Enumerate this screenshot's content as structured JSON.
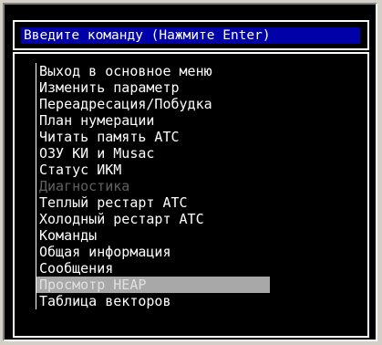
{
  "prompt": {
    "label": "Введите команду (Нажмите Enter)"
  },
  "menu": {
    "items": [
      {
        "label": "Выход в основное меню",
        "state": "normal"
      },
      {
        "label": "Изменить параметр",
        "state": "normal"
      },
      {
        "label": "Переадресация/Побудка",
        "state": "normal"
      },
      {
        "label": "План нумерации",
        "state": "normal"
      },
      {
        "label": "Читать память АТС",
        "state": "normal"
      },
      {
        "label": "ОЗУ КИ и Musac",
        "state": "normal"
      },
      {
        "label": "Статус ИКМ",
        "state": "normal"
      },
      {
        "label": "Диагностика",
        "state": "disabled"
      },
      {
        "label": "Теплый рестарт АТС",
        "state": "normal"
      },
      {
        "label": "Холодный рестарт АТС",
        "state": "normal"
      },
      {
        "label": "Команды",
        "state": "normal"
      },
      {
        "label": "Общая информация",
        "state": "normal"
      },
      {
        "label": "Сообщения",
        "state": "normal"
      },
      {
        "label": "Просмотр HEAP",
        "state": "selected"
      },
      {
        "label": "Таблица векторов",
        "state": "normal"
      }
    ]
  },
  "colors": {
    "prompt_bg": "#0000a8",
    "terminal_bg": "#000000",
    "text": "#ffffff",
    "disabled_text": "#606060",
    "selection_bg": "#a8a8a8"
  }
}
